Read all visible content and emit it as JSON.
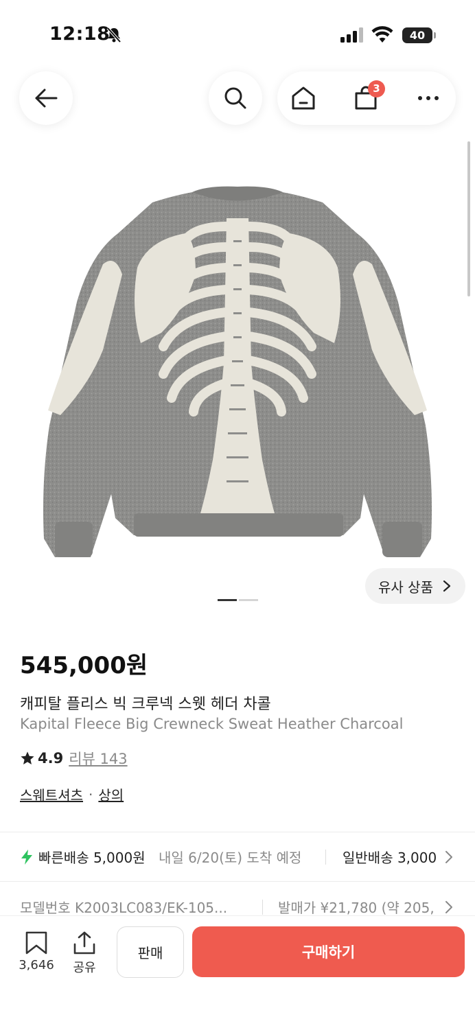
{
  "status_bar": {
    "time": "12:18",
    "battery": "40"
  },
  "nav": {
    "cart_count": "3"
  },
  "product": {
    "price": "545,000원",
    "title_ko": "캐피탈 플리스 빅 크루넥 스웻 헤더 차콜",
    "title_en": "Kapital Fleece Big Crewneck Sweat Heather Charcoal",
    "rating": "4.9",
    "review_label": "리뷰 143",
    "category": [
      "스웨트셔츠",
      "상의"
    ],
    "category_sep": "·"
  },
  "image": {
    "similar_label": "유사 상품",
    "page_count": 2,
    "current_page": 1
  },
  "shipping": {
    "fast_label": "빠른배송 5,000원",
    "fast_eta": "내일 6/20(토) 도착 예정",
    "normal_label": "일반배송 3,000"
  },
  "model": {
    "model_label": "모델번호 K2003LC083/EK-105...",
    "release_price": "발매가 ¥21,780 (약 205,"
  },
  "bottom_bar": {
    "wish_count": "3,646",
    "share_label": "공유",
    "sell_label": "판매",
    "buy_label": "구매하기"
  },
  "colors": {
    "accent": "#ef5b4f",
    "badge": "#ee5a50",
    "fast_delivery": "#2ec35f"
  }
}
